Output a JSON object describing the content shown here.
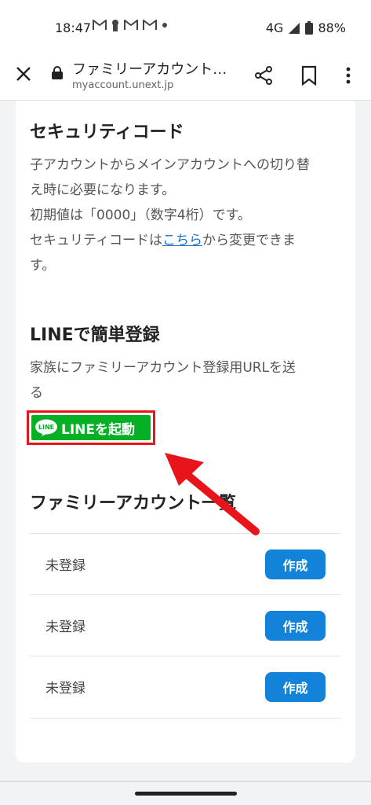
{
  "status_bar": {
    "time": "18:47",
    "network": "4G",
    "battery": "88%"
  },
  "browser": {
    "title": "ファミリーアカウント…",
    "url": "myaccount.unext.jp"
  },
  "security": {
    "heading": "セキュリティコード",
    "line1": "子アカウントからメインアカウントへの切り替",
    "line2": "え時に必要になります。",
    "line3": "初期値は「0000」（数字4桁）です。",
    "line4_pre": "セキュリティコードは",
    "line4_link": "こちら",
    "line4_post": "から変更できま",
    "line5": "す。"
  },
  "line_section": {
    "heading": "LINEで簡単登録",
    "desc1": "家族にファミリーアカウント登録用URLを送",
    "desc2": "る",
    "button_label": "LINEを起動",
    "logo_text": "LINE"
  },
  "accounts": {
    "heading": "ファミリーアカウント一覧",
    "rows": [
      {
        "label": "未登録",
        "button": "作成"
      },
      {
        "label": "未登録",
        "button": "作成"
      },
      {
        "label": "未登録",
        "button": "作成"
      }
    ]
  },
  "colors": {
    "line_green": "#06b025",
    "create_blue": "#1283d8",
    "highlight_red": "#e8141b",
    "link_blue": "#1a73c8"
  }
}
